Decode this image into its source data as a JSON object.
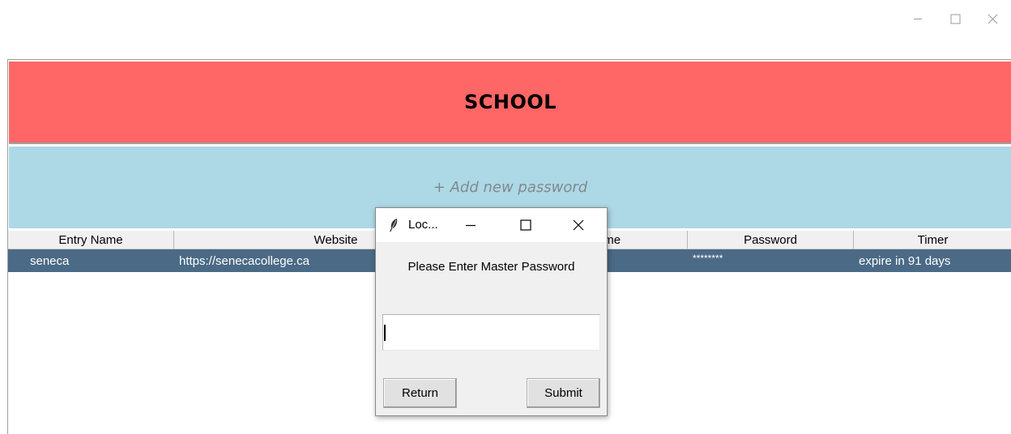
{
  "window": {
    "controls": {
      "minimize_icon": "minimize-icon",
      "maximize_icon": "maximize-icon",
      "close_icon": "close-icon"
    }
  },
  "header": {
    "title": "SCHOOL",
    "color": "#ff6666"
  },
  "add_banner": {
    "label": "+ Add new password",
    "color": "#add8e6"
  },
  "table": {
    "columns": [
      "Entry Name",
      "Website",
      "Username",
      "Password",
      "Timer"
    ],
    "rows": [
      {
        "entry_name": "seneca",
        "website": "https://senecacollege.ca",
        "username": "",
        "password": "********",
        "timer": "expire in 91 days"
      }
    ],
    "selected_row_color": "#4a6a85"
  },
  "dialog": {
    "title": "Loc...",
    "prompt": "Please Enter Master Password",
    "input_value": "",
    "return_label": "Return",
    "submit_label": "Submit",
    "icon": "feather-icon"
  }
}
